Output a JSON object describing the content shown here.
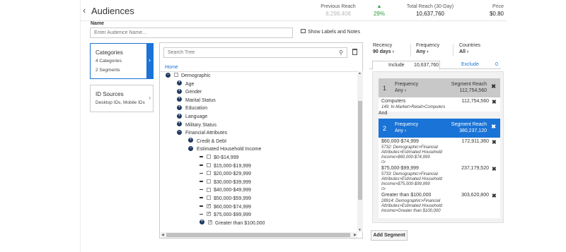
{
  "header": {
    "back_glyph": "‹",
    "title": "Audiences",
    "previous_reach_label": "Previous Reach",
    "previous_reach_value": "8,298,408",
    "change_value": "29%",
    "reach_label": "Total Reach (30-Day)",
    "reach_value": "10,637,760",
    "price_label": "Price",
    "price_value": "$0.80"
  },
  "name_field": {
    "label": "Name",
    "placeholder": "Enter Audience Name..."
  },
  "show_labels": "Show Labels and Notes",
  "left_cards": {
    "categories": {
      "title": "Categories",
      "line1": "4 Categories",
      "line2": "2 Segments"
    },
    "id_sources": {
      "title": "ID Sources",
      "line1": "Desktop IDs, Mobile IDs"
    }
  },
  "tree": {
    "search_placeholder": "Search Tree",
    "home": "Home",
    "items": [
      {
        "label": "Demographic",
        "type": "root"
      },
      {
        "label": "Age",
        "type": "expand"
      },
      {
        "label": "Gender",
        "type": "expand"
      },
      {
        "label": "Marital Status",
        "type": "expand"
      },
      {
        "label": "Education",
        "type": "expand"
      },
      {
        "label": "Language",
        "type": "expand"
      },
      {
        "label": "Military Status",
        "type": "expand"
      },
      {
        "label": "Financial Attributes",
        "type": "collapse"
      },
      {
        "label": "Credit & Debt",
        "type": "expand"
      },
      {
        "label": "Estimated Household Income",
        "type": "collapse"
      },
      {
        "label": "$0-$14,999",
        "type": "leaf",
        "checked": false
      },
      {
        "label": "$15,000-$19,999",
        "type": "leaf",
        "checked": false
      },
      {
        "label": "$20,000-$29,999",
        "type": "leaf",
        "checked": false
      },
      {
        "label": "$30,000-$39,999",
        "type": "leaf",
        "checked": false
      },
      {
        "label": "$40,000-$49,999",
        "type": "leaf",
        "checked": false
      },
      {
        "label": "$50,000-$59,999",
        "type": "leaf",
        "checked": false
      },
      {
        "label": "$60,000-$74,999",
        "type": "leaf",
        "checked": true
      },
      {
        "label": "$75,000-$99,999",
        "type": "leaf",
        "checked": true
      },
      {
        "label": "Greater than $100,000",
        "type": "leafexp",
        "checked": true
      }
    ]
  },
  "right": {
    "recency_label": "Recency",
    "recency_value": "90 days",
    "frequency_label": "Frequency",
    "frequency_value": "Any",
    "countries_label": "Countries",
    "countries_value": "All",
    "include_tab": "Include",
    "include_count": "10,637,760",
    "exclude_tab": "Exclude",
    "exclude_count": "0",
    "and_label": "And",
    "or_label": "Or",
    "segments": [
      {
        "num": "1",
        "freq_label": "Frequency",
        "freq_value": "Any",
        "reach_label": "Segment Reach",
        "reach_value": "112,754,560",
        "items": [
          {
            "name": "Computers",
            "reach": "112,754,560",
            "path": "149: In-Market>Retail>Computers"
          }
        ]
      },
      {
        "num": "2",
        "freq_label": "Frequency",
        "freq_value": "Any",
        "reach_label": "Segment Reach",
        "reach_value": "380,237,120",
        "items": [
          {
            "name": "$60,000-$74,999",
            "reach": "172,911,360",
            "path": "5732: Demographic>Financial Attributes>Estimated Household Income>$60,000-$74,999"
          },
          {
            "name": "$75,000-$99,999",
            "reach": "237,179,520",
            "path": "5733: Demographic>Financial Attributes>Estimated Household Income>$75,000-$99,999"
          },
          {
            "name": "Greater than $100,000",
            "reach": "303,620,800",
            "path": "28914: Demographic>Financial Attributes>Estimated Household Income>Greater than $100,000"
          }
        ]
      }
    ],
    "add_segment": "Add Segment"
  },
  "colors": {
    "accent": "#1a73d6",
    "positive": "#2a9d3a",
    "dark_node": "#1e3a5f"
  }
}
